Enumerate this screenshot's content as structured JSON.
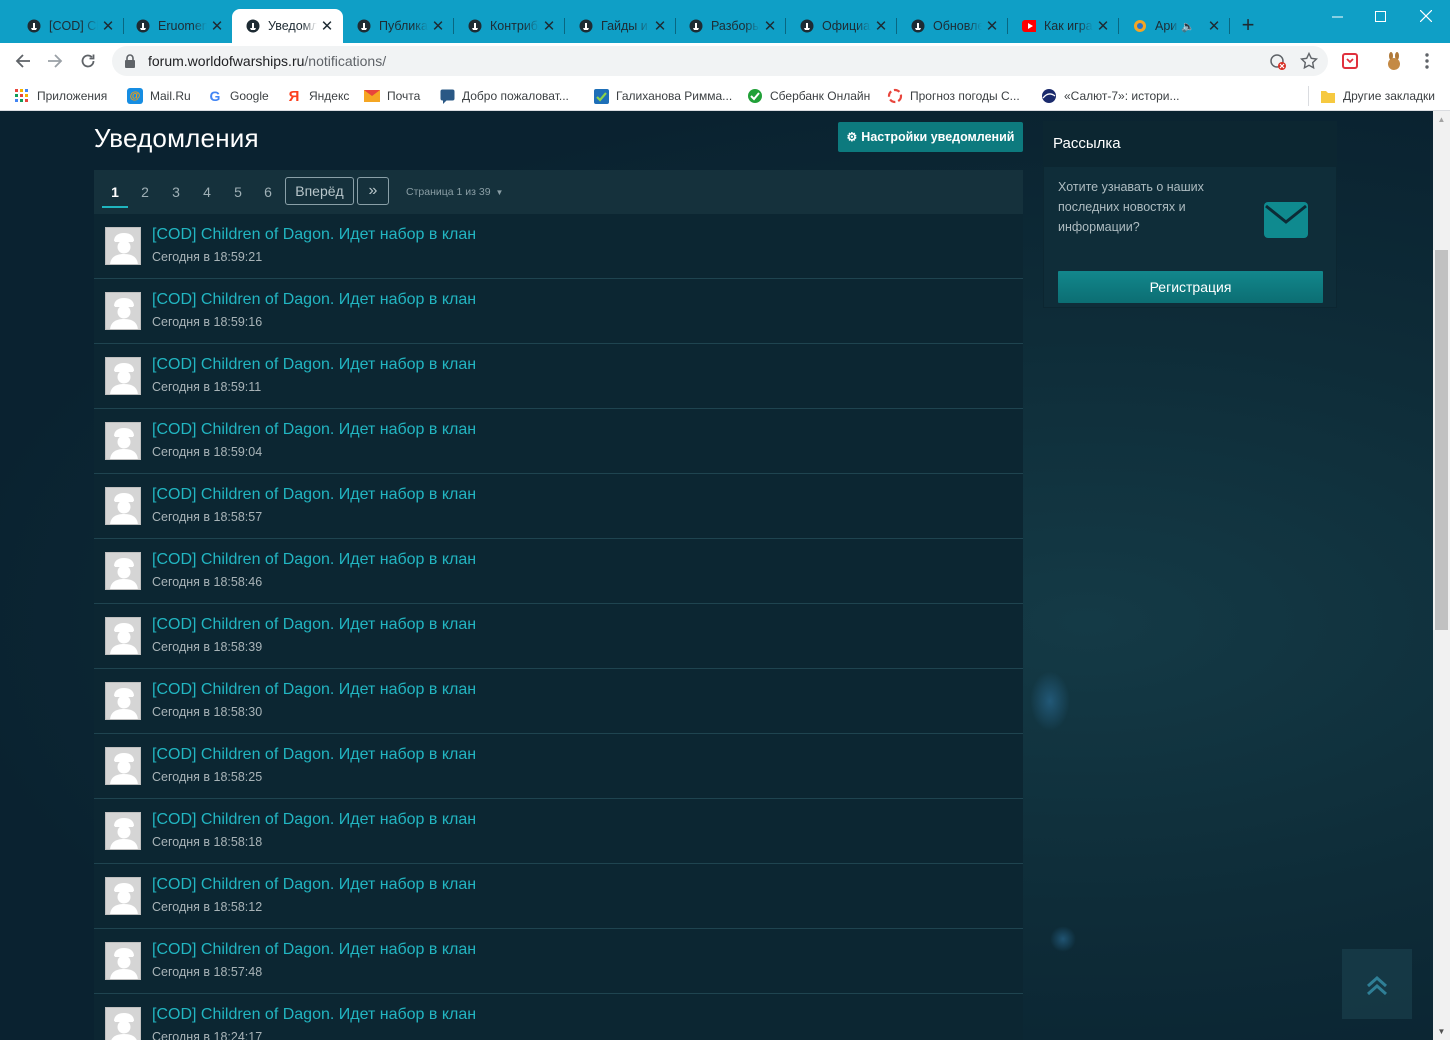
{
  "browser": {
    "tabs": [
      {
        "label": "[COD] Children of Dagon",
        "icon": "warships-icon",
        "active": false
      },
      {
        "label": "Eruomen",
        "icon": "warships-icon",
        "active": false
      },
      {
        "label": "Уведомления",
        "icon": "warships-icon",
        "active": true
      },
      {
        "label": "Публикации",
        "icon": "warships-icon",
        "active": false
      },
      {
        "label": "Контрибьюторы",
        "icon": "warships-icon",
        "active": false
      },
      {
        "label": "Гайды и статьи",
        "icon": "warships-icon",
        "active": false
      },
      {
        "label": "Разборы",
        "icon": "warships-icon",
        "active": false
      },
      {
        "label": "Официальные",
        "icon": "warships-icon",
        "active": false
      },
      {
        "label": "Обновление",
        "icon": "warships-icon",
        "active": false
      },
      {
        "label": "Как играть",
        "icon": "youtube-icon",
        "active": false
      },
      {
        "label": "Ари",
        "icon": "site-icon",
        "active": false
      }
    ],
    "url_host": "forum.worldofwarships.ru",
    "url_path": "/notifications/",
    "bookmarks": [
      {
        "label": "Приложения",
        "icon": "apps-grid-icon"
      },
      {
        "label": "Mail.Ru",
        "icon": "mailru-icon"
      },
      {
        "label": "Google",
        "icon": "google-icon"
      },
      {
        "label": "Яндекс",
        "icon": "yandex-icon"
      },
      {
        "label": "Почта",
        "icon": "mail-envelope-icon"
      },
      {
        "label": "Добро пожаловат...",
        "icon": "chat-bubble-icon"
      },
      {
        "label": "Галиханова Римма...",
        "icon": "checkbox-icon"
      },
      {
        "label": "Сбербанк Онлайн",
        "icon": "sberbank-icon"
      },
      {
        "label": "Прогноз погоды С...",
        "icon": "weather-ring-icon"
      },
      {
        "label": "«Салют-7»: истори...",
        "icon": "globe-icon"
      }
    ],
    "other_bookmarks": "Другие закладки"
  },
  "page": {
    "title": "Уведомления",
    "settings_button": "Настройки уведомлений",
    "pagination": {
      "pages": [
        "1",
        "2",
        "3",
        "4",
        "5",
        "6"
      ],
      "current": "1",
      "next_label": "Вперёд",
      "last_label": "»",
      "page_of": "Страница 1 из 39"
    },
    "notifications": [
      {
        "title": "[COD] Children of Dagon. Идет набор в клан",
        "time": "Сегодня в 18:59:21"
      },
      {
        "title": "[COD] Children of Dagon. Идет набор в клан",
        "time": "Сегодня в 18:59:16"
      },
      {
        "title": "[COD] Children of Dagon. Идет набор в клан",
        "time": "Сегодня в 18:59:11"
      },
      {
        "title": "[COD] Children of Dagon. Идет набор в клан",
        "time": "Сегодня в 18:59:04"
      },
      {
        "title": "[COD] Children of Dagon. Идет набор в клан",
        "time": "Сегодня в 18:58:57"
      },
      {
        "title": "[COD] Children of Dagon. Идет набор в клан",
        "time": "Сегодня в 18:58:46"
      },
      {
        "title": "[COD] Children of Dagon. Идет набор в клан",
        "time": "Сегодня в 18:58:39"
      },
      {
        "title": "[COD] Children of Dagon. Идет набор в клан",
        "time": "Сегодня в 18:58:30"
      },
      {
        "title": "[COD] Children of Dagon. Идет набор в клан",
        "time": "Сегодня в 18:58:25"
      },
      {
        "title": "[COD] Children of Dagon. Идет набор в клан",
        "time": "Сегодня в 18:58:18"
      },
      {
        "title": "[COD] Children of Dagon. Идет набор в клан",
        "time": "Сегодня в 18:58:12"
      },
      {
        "title": "[COD] Children of Dagon. Идет набор в клан",
        "time": "Сегодня в 18:57:48"
      },
      {
        "title": "[COD] Children of Dagon. Идет набор в клан",
        "time": "Сегодня в 18:24:17"
      }
    ]
  },
  "sidebar": {
    "newsletter_title": "Рассылка",
    "newsletter_text": "Хотите узнавать о наших последних новостях и информации?",
    "register_button": "Регистрация"
  },
  "colors": {
    "accent_teal": "#22b6c2",
    "button_teal": "#0d7a7e",
    "page_background": "#0b2430",
    "chrome_frame": "#0f9fc6"
  }
}
